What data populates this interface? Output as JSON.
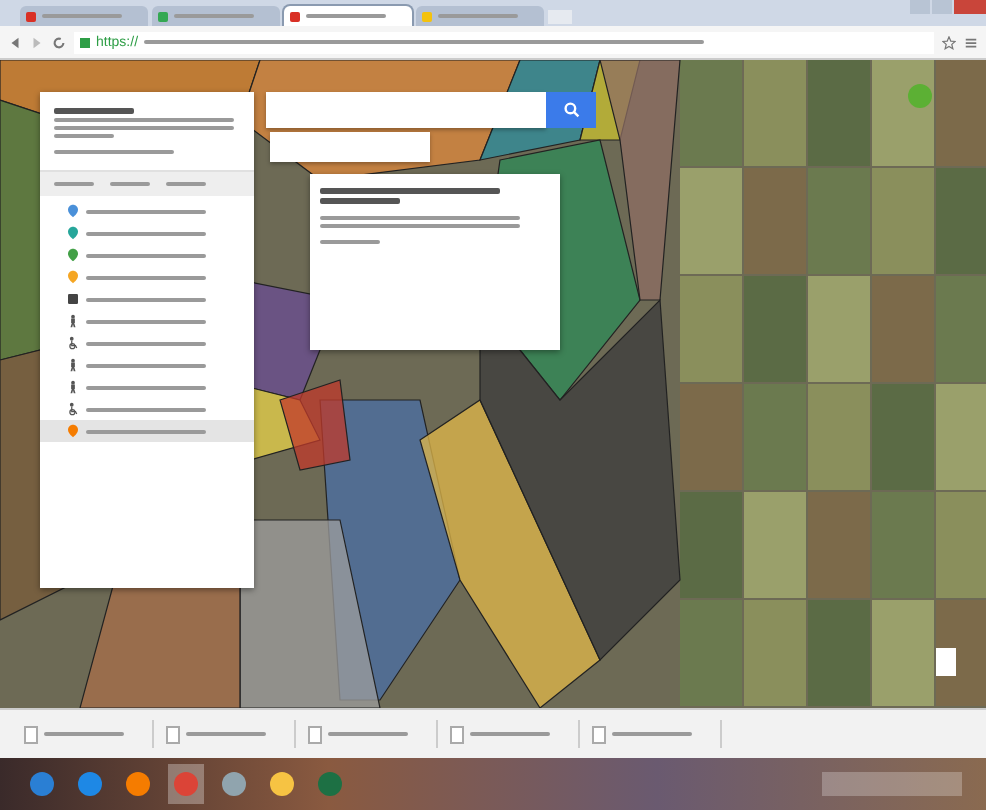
{
  "browser": {
    "tabs": [
      {
        "color": "#d93025",
        "selected": false
      },
      {
        "color": "#34a853",
        "selected": false
      },
      {
        "color": "#d93025",
        "selected": true
      },
      {
        "color": "#f4c20d",
        "selected": false
      }
    ],
    "url_scheme": "https://"
  },
  "legend": {
    "items": [
      {
        "kind": "pin",
        "color": "#4a90d9",
        "selected": false
      },
      {
        "kind": "pin",
        "color": "#26a69a",
        "selected": false
      },
      {
        "kind": "pin",
        "color": "#43a047",
        "selected": false
      },
      {
        "kind": "pin",
        "color": "#f5a623",
        "selected": false
      },
      {
        "kind": "bus",
        "color": "#444444",
        "selected": false
      },
      {
        "kind": "walker",
        "color": "#555555",
        "selected": false
      },
      {
        "kind": "wheelchair",
        "color": "#555555",
        "selected": false
      },
      {
        "kind": "walker",
        "color": "#555555",
        "selected": false
      },
      {
        "kind": "walker",
        "color": "#555555",
        "selected": false
      },
      {
        "kind": "wheelchair",
        "color": "#555555",
        "selected": false
      },
      {
        "kind": "pin",
        "color": "#f57c00",
        "selected": true
      }
    ]
  },
  "downloads": {
    "items": [
      {
        "kind": "file"
      },
      {
        "kind": "file"
      },
      {
        "kind": "file"
      },
      {
        "kind": "file"
      },
      {
        "kind": "file"
      }
    ]
  },
  "taskbar": {
    "apps": [
      {
        "kind": "start",
        "selected": false
      },
      {
        "kind": "ie",
        "selected": false
      },
      {
        "kind": "firefox",
        "selected": false
      },
      {
        "kind": "chrome",
        "selected": true
      },
      {
        "kind": "media",
        "selected": false
      },
      {
        "kind": "folder",
        "selected": false
      },
      {
        "kind": "excel",
        "selected": false
      }
    ]
  }
}
